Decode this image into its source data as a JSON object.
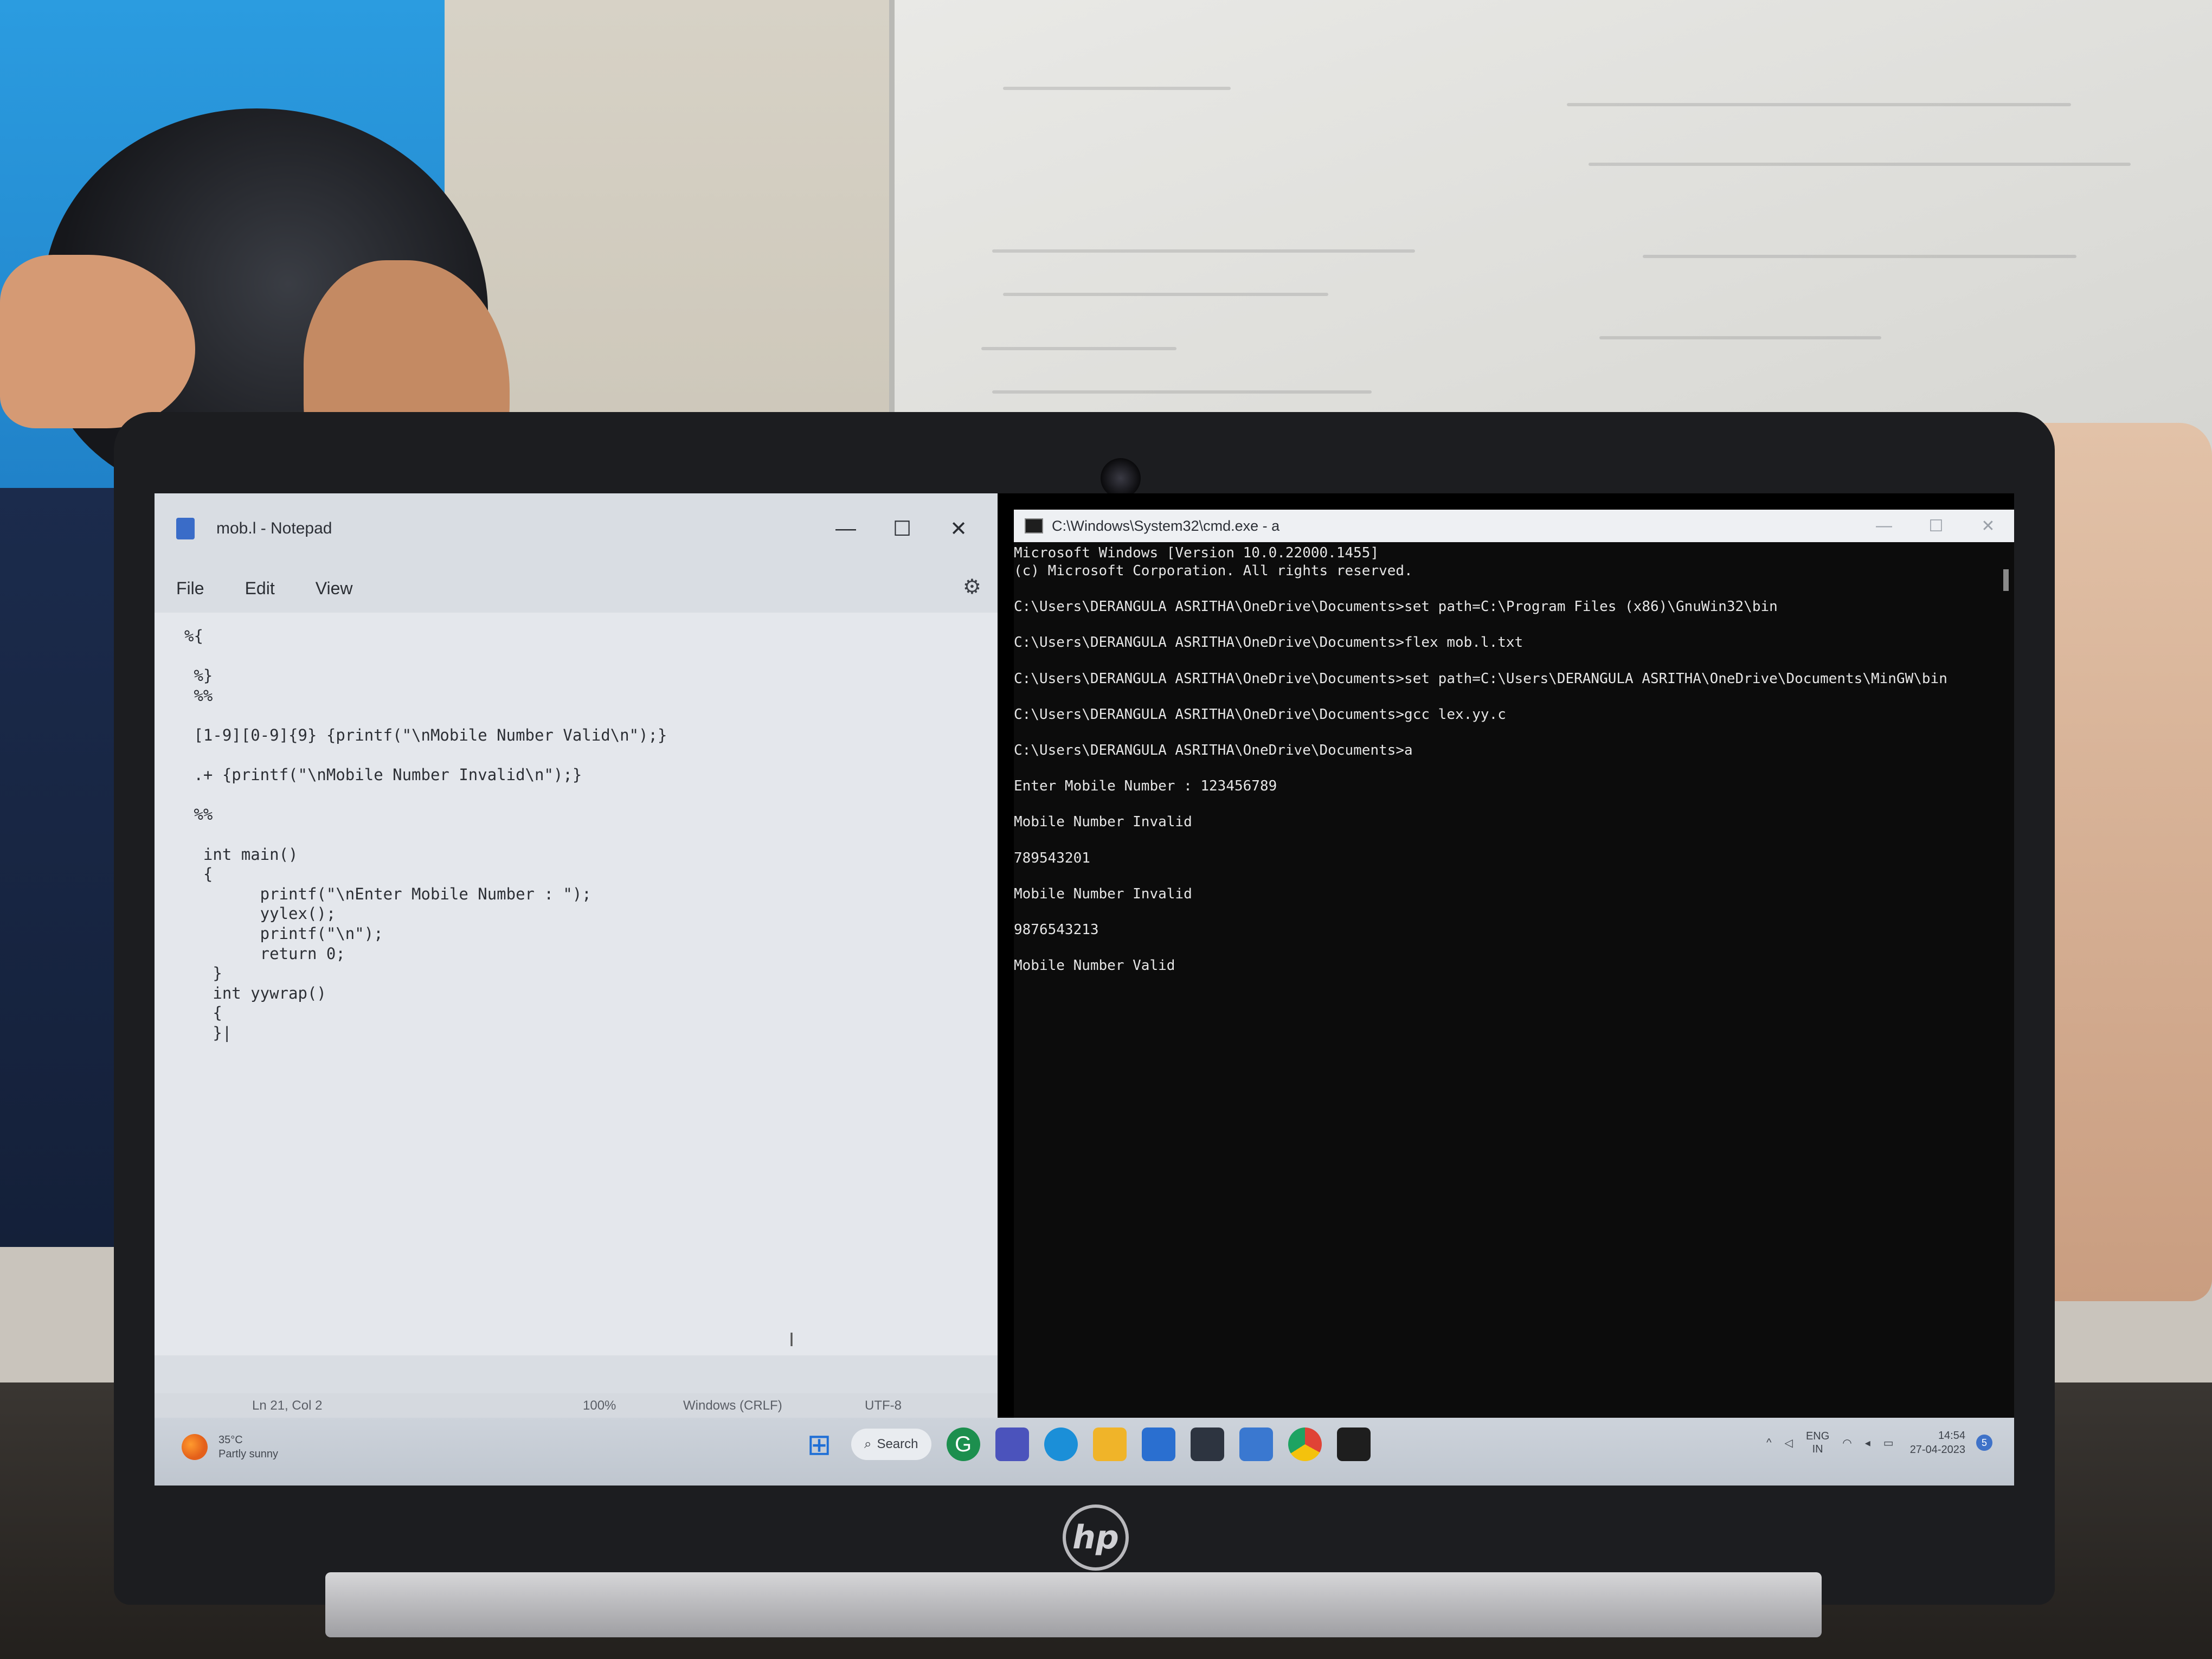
{
  "notepad": {
    "title": "mob.l - Notepad",
    "minimize_glyph": "—",
    "maximize_glyph": "☐",
    "close_glyph": "✕",
    "menus": [
      "File",
      "Edit",
      "View"
    ],
    "gear_glyph": "⚙",
    "code": "%{\n\n %}\n %%\n\n [1-9][0-9]{9} {printf(\"\\nMobile Number Valid\\n\");}\n\n .+ {printf(\"\\nMobile Number Invalid\\n\");}\n\n %%\n\n  int main()\n  {\n        printf(\"\\nEnter Mobile Number : \");\n        yylex();\n        printf(\"\\n\");\n        return 0;\n   }\n   int yywrap()\n   {\n   }|",
    "status": {
      "position": "Ln 21, Col 2",
      "zoom": "100%",
      "line_ending": "Windows (CRLF)",
      "encoding": "UTF-8"
    }
  },
  "cmd": {
    "title": "C:\\Windows\\System32\\cmd.exe - a",
    "minimize_glyph": "—",
    "maximize_glyph": "☐",
    "close_glyph": "✕",
    "output": "Microsoft Windows [Version 10.0.22000.1455]\n(c) Microsoft Corporation. All rights reserved.\n\nC:\\Users\\DERANGULA ASRITHA\\OneDrive\\Documents>set path=C:\\Program Files (x86)\\GnuWin32\\bin\n\nC:\\Users\\DERANGULA ASRITHA\\OneDrive\\Documents>flex mob.l.txt\n\nC:\\Users\\DERANGULA ASRITHA\\OneDrive\\Documents>set path=C:\\Users\\DERANGULA ASRITHA\\OneDrive\\Documents\\MinGW\\bin\n\nC:\\Users\\DERANGULA ASRITHA\\OneDrive\\Documents>gcc lex.yy.c\n\nC:\\Users\\DERANGULA ASRITHA\\OneDrive\\Documents>a\n\nEnter Mobile Number : 123456789\n\nMobile Number Invalid\n\n789543201\n\nMobile Number Invalid\n\n9876543213\n\nMobile Number Valid"
  },
  "taskbar": {
    "weather_temp": "35°C",
    "weather_desc": "Partly sunny",
    "search_label": "Search",
    "start_glyph": "⊞",
    "tray_lang": "ENG",
    "tray_region": "IN",
    "time": "14:54",
    "date": "27-04-2023",
    "notification_count": "5"
  },
  "device": {
    "logo_text": "hp"
  },
  "colors": {
    "cmd_background": "#0c0c0c",
    "notepad_background": "#e4e7ec",
    "taskbar_background": "#c6ccd4"
  }
}
